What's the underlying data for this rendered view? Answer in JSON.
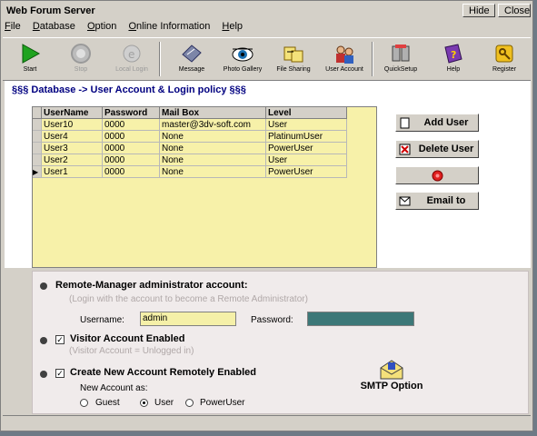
{
  "window": {
    "title": "Web Forum Server",
    "hide_label": "Hide",
    "close_label": "Close"
  },
  "menu": [
    {
      "label": "File",
      "u": "F",
      "rest": "ile"
    },
    {
      "label": "Database",
      "u": "D",
      "rest": "atabase"
    },
    {
      "label": "Option",
      "u": "O",
      "rest": "ption"
    },
    {
      "label": "Online Information",
      "u": "O",
      "rest": "nline Information"
    },
    {
      "label": "Help",
      "u": "H",
      "rest": "elp"
    }
  ],
  "toolbar": {
    "start": "Start",
    "stop": "Stop",
    "local_login": "Local Login",
    "message": "Message",
    "photo_gallery": "Photo Gallery",
    "file_sharing": "File Sharing",
    "user_account": "User Account",
    "quicksetup": "QuickSetup",
    "help": "Help",
    "register": "Register"
  },
  "breadcrumb": "§§§ Database -> User Account & Login policy §§§",
  "table": {
    "headers": [
      "UserName",
      "Password",
      "Mail Box",
      "Level"
    ],
    "rows": [
      [
        "User10",
        "0000",
        "master@3dv-soft.com",
        "User"
      ],
      [
        "User4",
        "0000",
        "None",
        "PlatinumUser"
      ],
      [
        "User3",
        "0000",
        "None",
        "PowerUser"
      ],
      [
        "User2",
        "0000",
        "None",
        "User"
      ],
      [
        "User1",
        "0000",
        "None",
        "PowerUser"
      ]
    ],
    "selected_row": 4
  },
  "side_buttons": {
    "add_user": "Add User",
    "delete_user": "Delete User",
    "email_to": "Email to"
  },
  "remote": {
    "title": "Remote-Manager administrator account:",
    "hint": "(Login with the account to become a Remote Administrator)",
    "username_label": "Username:",
    "username_value": "admin",
    "password_label": "Password:"
  },
  "visitor": {
    "title": "Visitor Account Enabled",
    "hint": "(Visitor Account = Unlogged in)",
    "checked": true
  },
  "create": {
    "title": "Create New Account Remotely Enabled",
    "checked": true,
    "new_as_label": "New Account as:",
    "options": [
      "Guest",
      "User",
      "PowerUser"
    ],
    "selected": "User"
  },
  "smtp_label": "SMTP Option",
  "colors": {
    "grid_bg": "#f7f1a9",
    "password_field": "#3d7878",
    "username_field": "#f5f0a8"
  }
}
